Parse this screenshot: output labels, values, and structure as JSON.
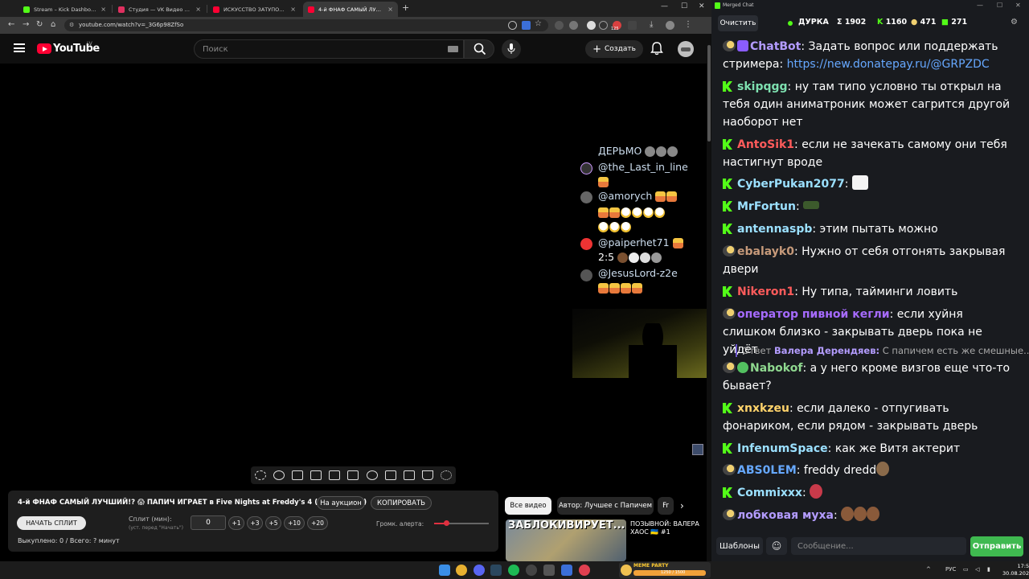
{
  "browser": {
    "tabs": [
      {
        "title": "Stream – Kick Dashboard",
        "color": "#53fc18"
      },
      {
        "title": "Студия — VK Видео Live",
        "color": "#e03060"
      },
      {
        "title": "ИСКУССТВО ЗАТУПОВ - YouTube",
        "color": "#ff0033"
      },
      {
        "title": "4-й ФНАФ САМЫЙ ЛУЧШИ...",
        "color": "#ff0033"
      }
    ],
    "url": "youtube.com/watch?v=_3G6p98ZfSo",
    "ext_badge": "125"
  },
  "youtube": {
    "logo_text": "YouTube",
    "country": "LV",
    "search_placeholder": "Поиск",
    "create_label": "Создать"
  },
  "overlay_chat": {
    "lines": [
      {
        "text": "ДЕРЬМО"
      },
      {
        "text": "@the_Last_in_line"
      },
      {
        "text": "@amorych"
      },
      {
        "text": "@paiperhet71"
      },
      {
        "text": "2:5"
      },
      {
        "text": "@JesusLord-z2e"
      }
    ]
  },
  "extension": {
    "title": "4-й ФНАФ САМЫЙ ЛУЧШИЙ!? 😱 ПАПИЧ ИГРАЕТ в Five Nights at Freddy's 4 (не страшно)",
    "auction_label": "На аукцион",
    "copy_label": "КОПИРОВАТЬ",
    "start_split_label": "НАЧАТЬ СПЛИТ",
    "split_label": "Сплит (мин):",
    "split_hint": "(уст. перед \"Начать\")",
    "split_value": "0",
    "increments": [
      "+1",
      "+3",
      "+5",
      "+10",
      "+20"
    ],
    "alert_label": "Громк. алерта:",
    "alert_volume": 0.22,
    "purchased": "Выкуплено: 0 / Всего: ? минут"
  },
  "recommendations": {
    "chips": [
      "Все видео",
      "Автор: Лучшее с Папичем",
      "Fr"
    ],
    "thumb_text": "ЗАБЛОКИВИРУЕТ...",
    "title": "ПОЗЫВНОЙ: ВАЛЕРА ХАОС 🇺🇦 #1"
  },
  "chat": {
    "window_title": "Merged Chat",
    "clear_label": "Очистить",
    "channel": "ДУРКА",
    "stats": [
      {
        "icon": "Σ",
        "value": "1902"
      },
      {
        "icon": "K",
        "value": "1160"
      },
      {
        "icon": "●",
        "value": "471"
      },
      {
        "icon": "■",
        "value": "271"
      }
    ],
    "messages": [
      {
        "platform": "youtube",
        "nick": "ChatBot",
        "color": "#b39cff",
        "text": "Задать вопрос или поддержать стримера: ",
        "link": "https://new.donatepay.ru/@GRPZDC"
      },
      {
        "platform": "kick",
        "nick": "skipqgg",
        "color": "#7ee0b0",
        "text": "ну там типо условно ты открыл на тебя один аниматроник может сагрится другой наоборот нет"
      },
      {
        "platform": "kick",
        "nick": "AntoSik1",
        "color": "#ff5b5b",
        "text": "если не зачекать самому они тебя настигнут вроде"
      },
      {
        "platform": "kick",
        "nick": "CyberPukan2077",
        "color": "#9be0ff",
        "text": ""
      },
      {
        "platform": "kick",
        "nick": "MrFortun",
        "color": "#9be0ff",
        "text": ""
      },
      {
        "platform": "kick",
        "nick": "antennaspb",
        "color": "#9be0ff",
        "text": "этим пытать можно"
      },
      {
        "platform": "youtube",
        "nick": "ebalayk0",
        "color": "#c69a7a",
        "text": "Нужно от себя отгонять закрывая двери"
      },
      {
        "platform": "kick",
        "nick": "Nikeron1",
        "color": "#ff5b5b",
        "text": "Ну типа, тайминги ловить"
      },
      {
        "platform": "youtube",
        "nick": "оператор пивной кегли",
        "color": "#a66bff",
        "text": "если хуйня слишком близко - закрывать дверь пока не уйдёт"
      },
      {
        "platform": "youtube",
        "nick": "Nabokof",
        "color": "#8fd88f",
        "text": "а у него кроме визгов еще что-то бывает?"
      },
      {
        "platform": "kick",
        "nick": "xnxkzeu",
        "color": "#ffd36b",
        "text": "если далеко - отпугивать фонариком, если рядом - закрывать дверь"
      },
      {
        "platform": "kick",
        "nick": "InfenumSpace",
        "color": "#9be0ff",
        "text": "как же Витя актерит"
      },
      {
        "platform": "youtube",
        "nick": "ABS0LEM",
        "color": "#66a8ff",
        "text": "freddy dredd"
      },
      {
        "platform": "kick",
        "nick": "Commixxx",
        "color": "#9be0ff",
        "text": ""
      },
      {
        "platform": "youtube",
        "nick": "лобковая муха",
        "color": "#b39cff",
        "text": ""
      }
    ],
    "reply": {
      "prefix": "Ответ",
      "name": "Валера Дерендяев:",
      "text": "С папичем есть же смешные..."
    },
    "templates_label": "Шаблоны",
    "input_placeholder": "Сообщение...",
    "send_label": "Отправить"
  },
  "taskbar": {
    "widget_label": "MEME PARTY",
    "widget_value": "1250 / 1500",
    "lang": "РУС",
    "time": "17:59",
    "date": "30.08.2026"
  }
}
